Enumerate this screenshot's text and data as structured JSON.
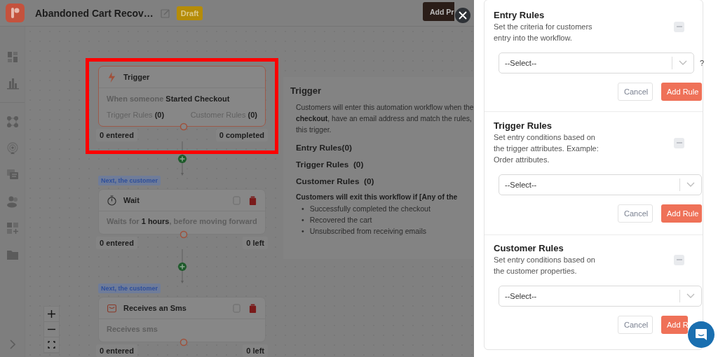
{
  "header": {
    "title": "Abandoned Cart Recov…",
    "status": "Draft",
    "action": "Add Pr"
  },
  "flow": {
    "nodes": [
      {
        "kind": "trigger",
        "highlighted": true,
        "title": "Trigger",
        "description": "When someone **Started Checkout**",
        "rules": [
          "Trigger Rules **(0)**",
          "Customer Rules **(0)**"
        ],
        "stats": [
          "0 entered",
          "0 completed"
        ]
      },
      {
        "kind": "wait",
        "highlighted": false,
        "badge": "Next, the customer",
        "title": "Wait",
        "description": "Waits for **1 hours**, before moving forward",
        "stats": [
          "0 entered",
          "0 left"
        ]
      },
      {
        "kind": "sms",
        "highlighted": false,
        "badge": "Next, the customer",
        "title": "Receives an Sms",
        "description": "Receives sms",
        "stats": [
          "0 entered",
          "0 left"
        ]
      }
    ]
  },
  "detail": {
    "title": "Trigger",
    "paragraph": "Customers will enter this automation workflow when the\n**checkout**, have an email address and match the rules,\nthis trigger.",
    "rule_counts": [
      "Entry Rules(0)",
      "Trigger Rules  (0)",
      "Customer Rules  (0)"
    ],
    "exit_heading": "Customers will exit this workflow if [Any of the",
    "exit_conditions": [
      {
        "bullet": "•",
        "text": "Successfully completed the checkout"
      },
      {
        "bullet": "•",
        "text": "Recovered the cart"
      },
      {
        "bullet": "•",
        "text": "Unsubscribed from receiving emails"
      }
    ]
  },
  "rules_panel": {
    "sections": [
      {
        "title": "Entry Rules",
        "description": "Set the criteria for customers\nentry into the workflow.",
        "placeholder": "--Select--",
        "help": "?",
        "buttons": [
          {
            "label": "Cancel",
            "kind": "secondary"
          },
          {
            "label": "Add Rule",
            "kind": "primary"
          }
        ]
      },
      {
        "title": "Trigger Rules",
        "description": "Set entry conditions based on\nthe trigger attributes. Example:\nOrder attributes.",
        "placeholder": "--Select--",
        "buttons": [
          {
            "label": "Cancel",
            "kind": "secondary"
          },
          {
            "label": "Add Rule",
            "kind": "primary"
          }
        ]
      },
      {
        "title": "Customer Rules",
        "description": "Set entry conditions based on\nthe customer properties.",
        "placeholder": "--Select--",
        "buttons": [
          {
            "label": "Cancel",
            "kind": "secondary"
          },
          {
            "label": "Add R",
            "kind": "primary"
          }
        ]
      }
    ]
  }
}
